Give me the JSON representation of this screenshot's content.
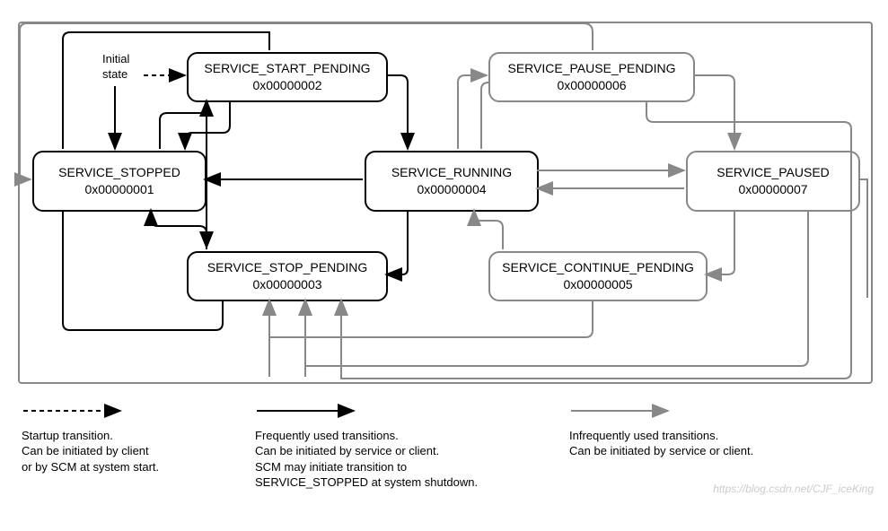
{
  "initial_state": {
    "line1": "Initial",
    "line2": "state"
  },
  "nodes": {
    "stopped": {
      "title": "SERVICE_STOPPED",
      "code": "0x00000001"
    },
    "start_pending": {
      "title": "SERVICE_START_PENDING",
      "code": "0x00000002"
    },
    "running": {
      "title": "SERVICE_RUNNING",
      "code": "0x00000004"
    },
    "stop_pending": {
      "title": "SERVICE_STOP_PENDING",
      "code": "0x00000003"
    },
    "pause_pending": {
      "title": "SERVICE_PAUSE_PENDING",
      "code": "0x00000006"
    },
    "continue_pending": {
      "title": "SERVICE_CONTINUE_PENDING",
      "code": "0x00000005"
    },
    "paused": {
      "title": "SERVICE_PAUSED",
      "code": "0x00000007"
    }
  },
  "legend": {
    "startup": {
      "title": "Startup transition.",
      "line2": "Can be initiated by client",
      "line3": "or by SCM at system start."
    },
    "frequent": {
      "title": "Frequently used transitions.",
      "line2": "Can be initiated by service or client.",
      "line3": "SCM may initiate transition to",
      "line4": "SERVICE_STOPPED at system shutdown."
    },
    "infrequent": {
      "title": "Infrequently used transitions.",
      "line2": "Can be initiated by service or client."
    }
  },
  "watermark": "https://blog.csdn.net/CJF_iceKing"
}
